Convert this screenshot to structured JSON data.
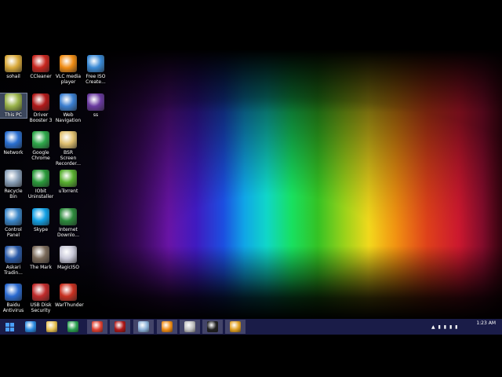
{
  "desktop": {
    "icons": [
      {
        "label": "sohail",
        "color": "#d9a93a"
      },
      {
        "label": "CCleaner",
        "color": "#c8261e"
      },
      {
        "label": "VLC media player",
        "color": "#f08c14"
      },
      {
        "label": "Free ISO Create...",
        "color": "#3a8ad6"
      },
      {
        "label": "This PC",
        "color": "#9ab34a"
      },
      {
        "label": "Driver Booster 3",
        "color": "#b01818"
      },
      {
        "label": "Web Navigation",
        "color": "#3b7fd0"
      },
      {
        "label": "ss",
        "color": "#6a3aa0"
      },
      {
        "label": "Network",
        "color": "#2a6fd0"
      },
      {
        "label": "Google Chrome",
        "color": "#2ea84a"
      },
      {
        "label": "BSR Screen Recorder...",
        "color": "#e0c070"
      },
      {
        "label": "Recycle Bin",
        "color": "#8aa0b8"
      },
      {
        "label": "IObit Uninstaller",
        "color": "#2a9a3a"
      },
      {
        "label": "uTorrent",
        "color": "#58b030"
      },
      {
        "label": "Control Panel",
        "color": "#3a86c8"
      },
      {
        "label": "Skype",
        "color": "#12a0e4"
      },
      {
        "label": "Internet Downlo...",
        "color": "#2c8a3c"
      },
      {
        "label": "Askari Tradin...",
        "color": "#2a5aa8"
      },
      {
        "label": "The Mark",
        "color": "#7a6a5a"
      },
      {
        "label": "MagicISO",
        "color": "#c8c8d8"
      },
      {
        "label": "Baidu Antivirus",
        "color": "#2a6ad0"
      },
      {
        "label": "USB Disk Security",
        "color": "#c02a2a"
      },
      {
        "label": "WarThunder",
        "color": "#c83020"
      }
    ]
  },
  "taskbar": {
    "items": [
      {
        "name": "start-button",
        "color": "#4aa0ff"
      },
      {
        "name": "ie-icon",
        "color": "#2a8ae0"
      },
      {
        "name": "file-explorer-icon",
        "color": "#e8c050"
      },
      {
        "name": "store-icon",
        "color": "#2aa050"
      },
      {
        "name": "chrome-icon",
        "color": "#e04030"
      },
      {
        "name": "driver-booster-icon",
        "color": "#b01818"
      },
      {
        "name": "notepad-icon",
        "color": "#8ab0d8"
      },
      {
        "name": "vlc-icon",
        "color": "#f08c14"
      },
      {
        "name": "app-icon",
        "color": "#c0c0c0"
      },
      {
        "name": "cmd-icon",
        "color": "#202020"
      },
      {
        "name": "tiles-icon",
        "color": "#e0a020"
      }
    ],
    "clock_time": "1:23 AM"
  }
}
